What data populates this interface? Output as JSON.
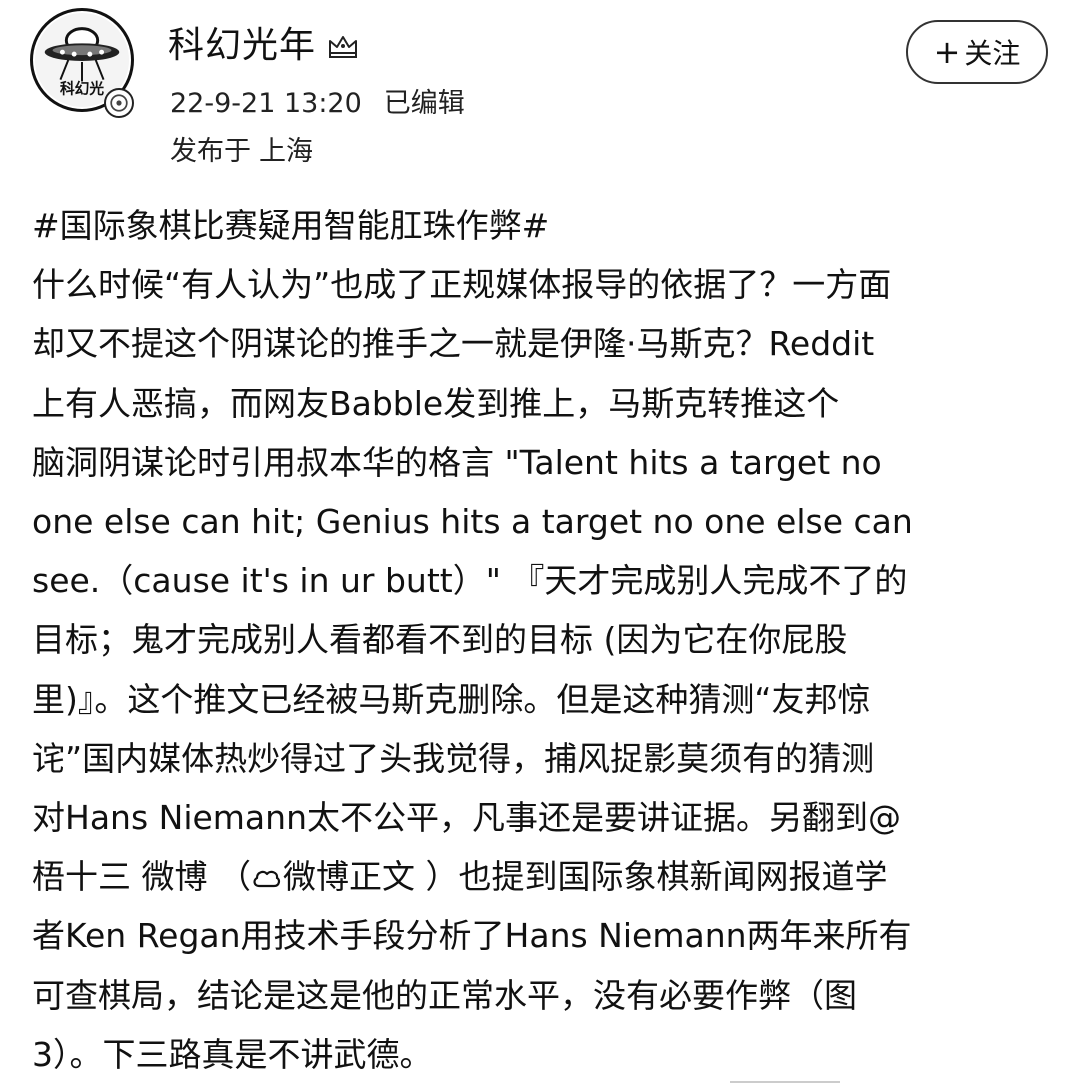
{
  "header": {
    "username": "科幻光年",
    "avatar_label": "科幻光年",
    "timestamp": "22-9-21 13:20",
    "edited_label": "已编辑",
    "location_prefix": "发布于",
    "location": "上海",
    "follow_plus": "+",
    "follow_label": "关注"
  },
  "post": {
    "hashtag": "#国际象棋比赛疑用智能肛珠作弊#",
    "lines": [
      "什么时候“有人认为”也成了正规媒体报导的依据了？一方面",
      "却又不提这个阴谋论的推手之一就是伊隆·马斯克？Reddit",
      "上有人恶搞，而网友Babble发到推上，马斯克转推这个",
      "脑洞阴谋论时引用叔本华的格言 \"Talent hits a target no",
      "one else can hit; Genius hits a target no one else can",
      "see.（cause it's in ur butt）\" 『天才完成别人完成不了的",
      "目标；鬼才完成别人看都看不到的目标 (因为它在你屁股",
      "里)』。这个推文已经被马斯克删除。但是这种猜测“友邦惊",
      "诧”国内媒体热炒得过了头我觉得，捕风捉影莫须有的猜测",
      "对Hans Niemann太不公平，凡事还是要讲证据。另翻到@"
    ],
    "line11_mention": "梧十三 微博",
    "line11_link_prefix": " （",
    "line11_link_text": "微博正文",
    "line11_rest": " ）也提到国际象棋新闻网报道学",
    "lines_after": [
      "者Ken Regan用技术手段分析了Hans Niemann两年来所有",
      "可查棋局，结论是这是他的正常水平，没有必要作弊（图",
      "3）。下三路真是不讲武德。"
    ]
  },
  "icons": {
    "avatar": "ufo-avatar-icon",
    "badge": "verified-badge-icon",
    "level": "crown-level-icon",
    "link": "cloud-weibo-icon"
  }
}
